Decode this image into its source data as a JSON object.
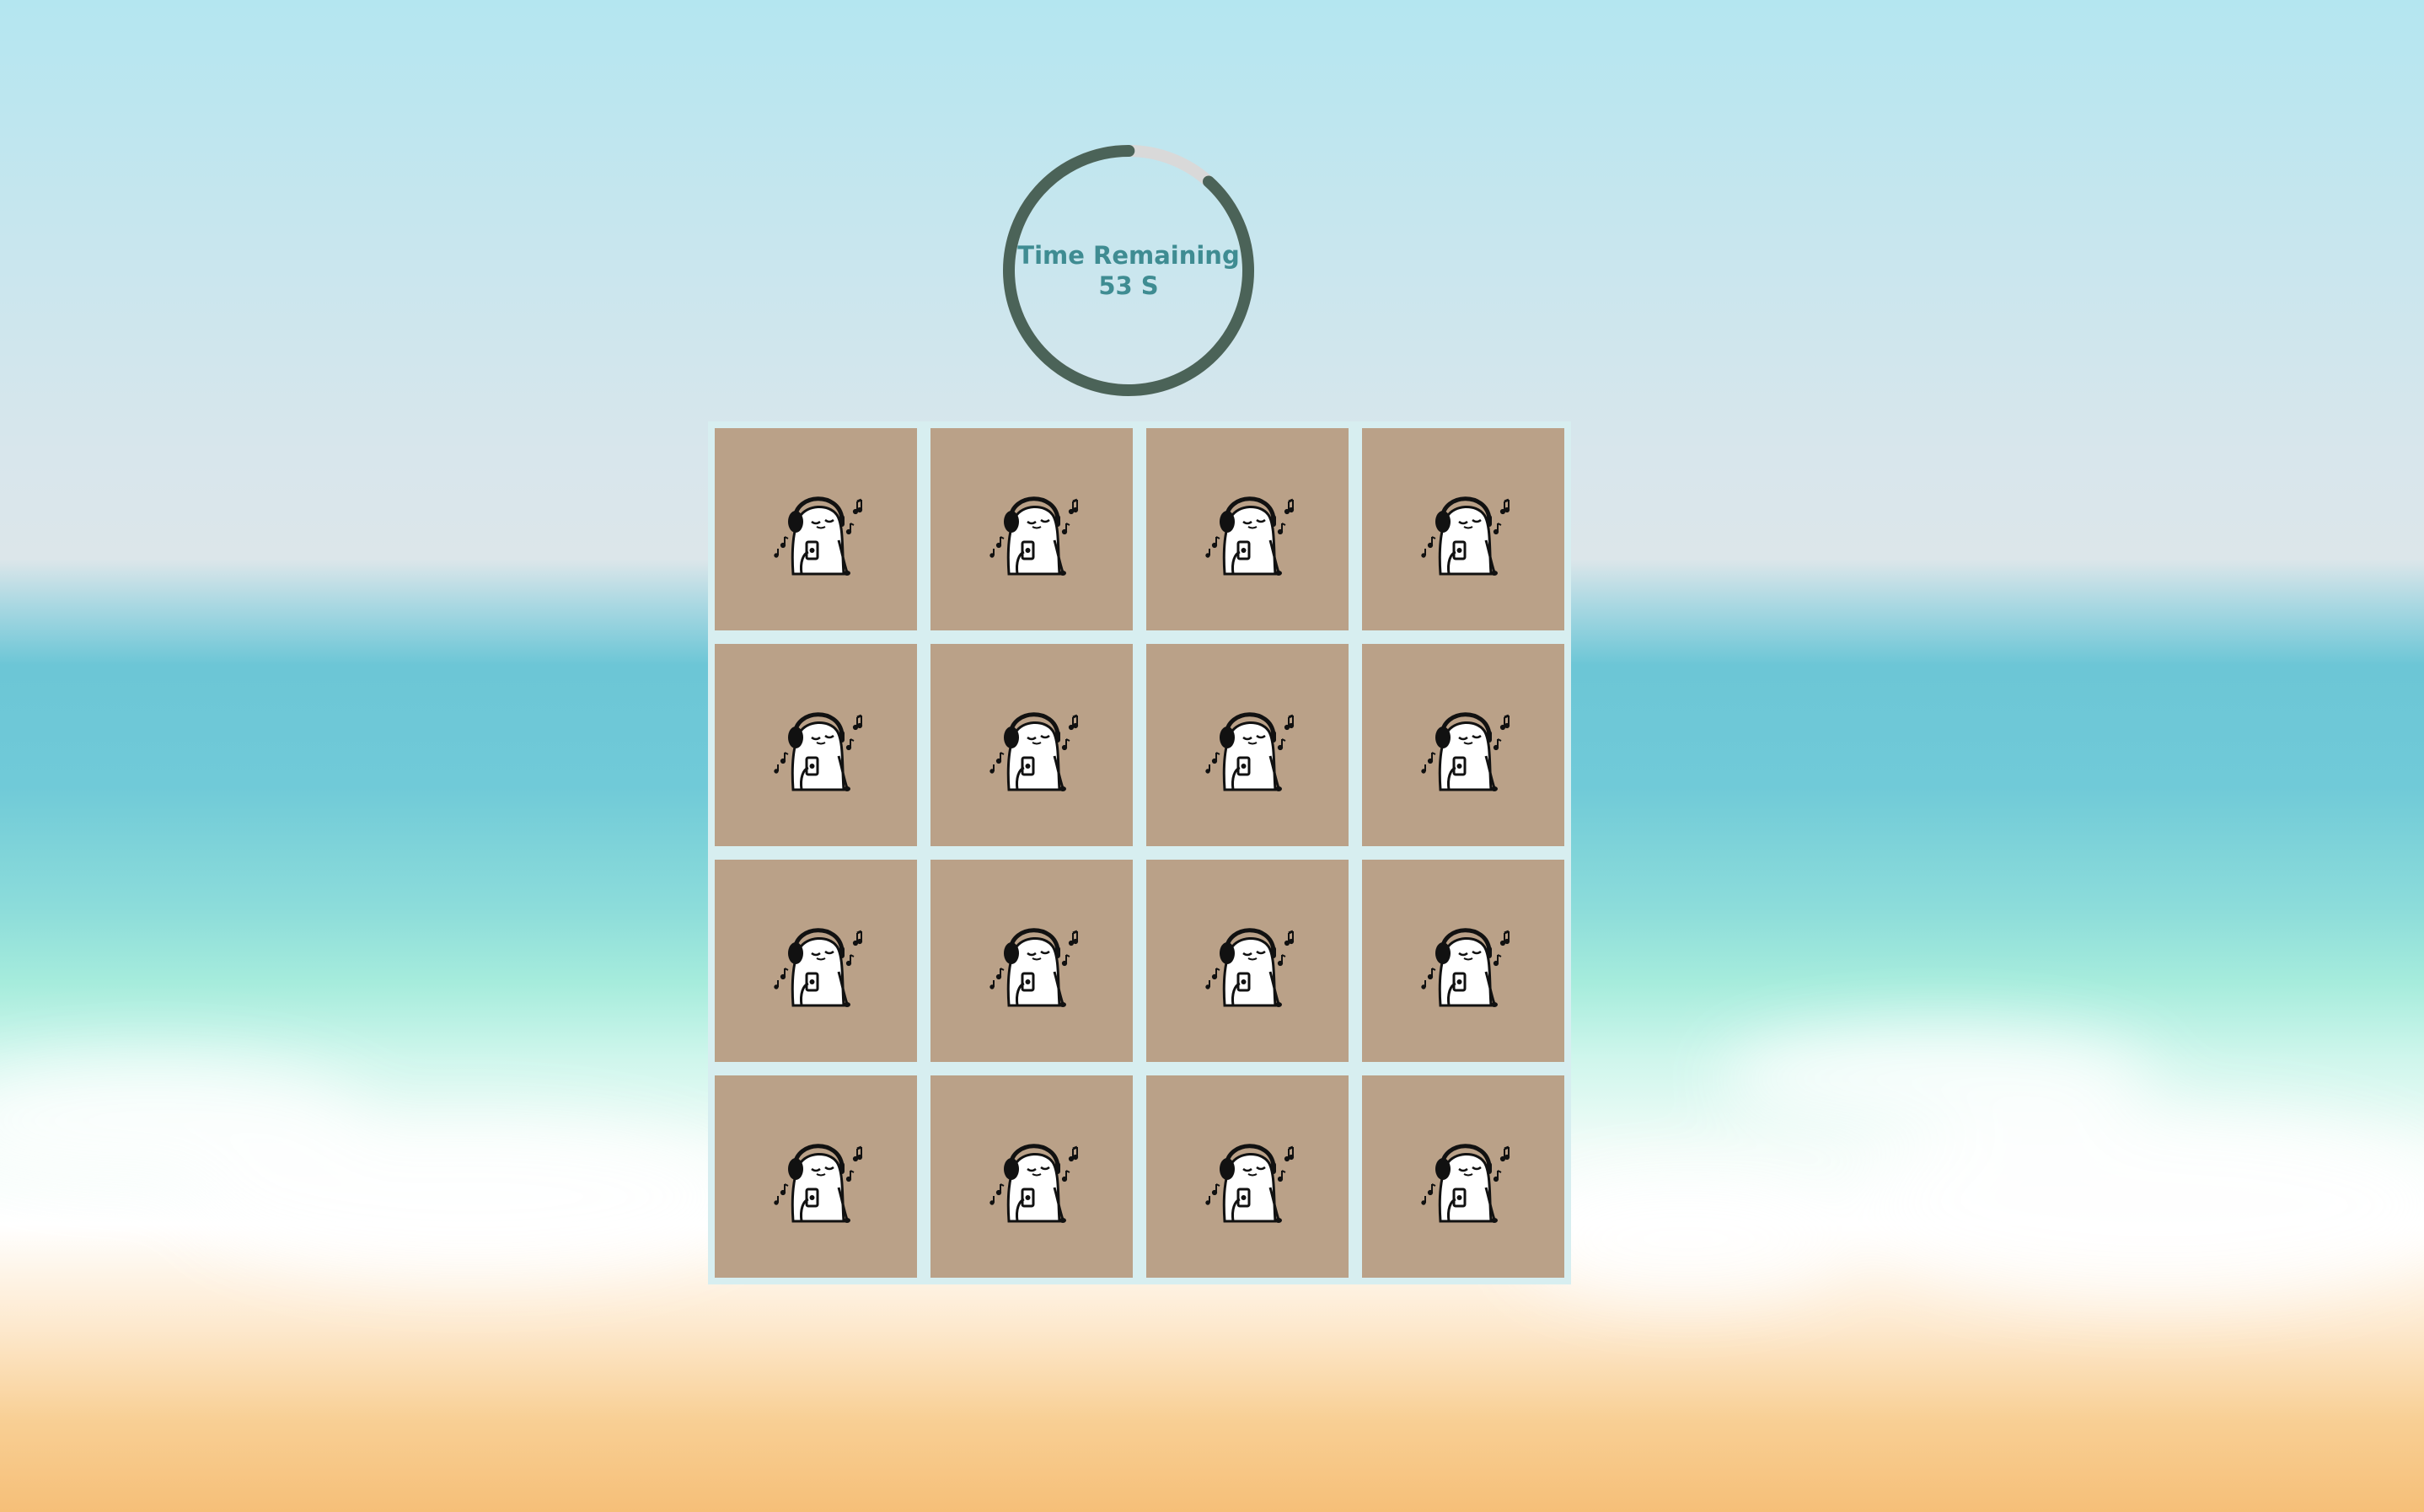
{
  "timer": {
    "label": "Time Remaining",
    "value_text": "53 S",
    "seconds_remaining": 53,
    "total_seconds": 60,
    "ring_color": "#4b6358",
    "track_color": "#d9d9d9",
    "text_color": "#3f8c92"
  },
  "board": {
    "rows": 4,
    "columns": 4,
    "card_back_color": "#baa188",
    "card_back_icon": "headphones-blob-music-icon",
    "cards_face_down": 16
  }
}
